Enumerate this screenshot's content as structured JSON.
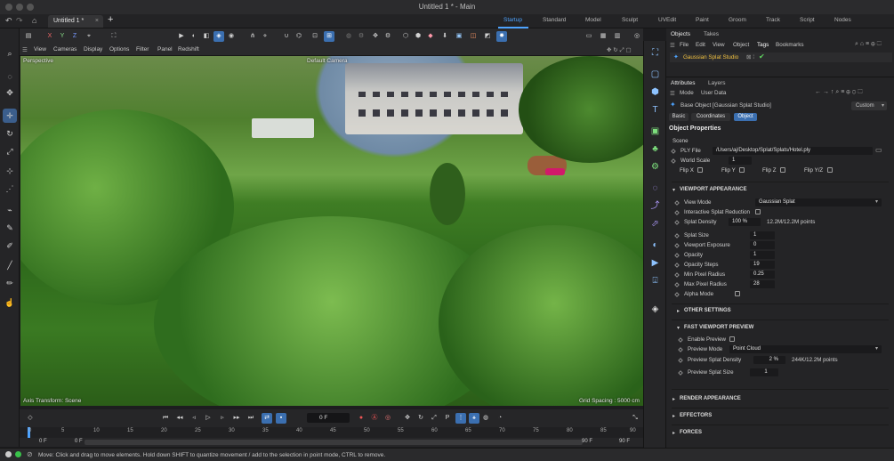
{
  "window": {
    "title": "Untitled 1 * - Main"
  },
  "tabs": {
    "doc_tab": "Untitled 1 *",
    "add": "+"
  },
  "layouts": [
    "Startup",
    "Standard",
    "Model",
    "Sculpt",
    "UVEdit",
    "Paint",
    "Groom",
    "Track",
    "Script",
    "Nodes"
  ],
  "toolbar_axes": {
    "x": "X",
    "y": "Y",
    "z": "Z"
  },
  "viewport": {
    "menu": [
      "View",
      "Cameras",
      "Display",
      "Options",
      "Filter",
      "Panel",
      "Redshift"
    ],
    "perspective": "Perspective",
    "camera": "Default Camera",
    "transform_label": "Axis Transform: Scene",
    "grid_label": "Grid Spacing : 5000 cm"
  },
  "timeline": {
    "frame_field": "0 F",
    "ruler_ticks": [
      "0",
      "5",
      "10",
      "15",
      "20",
      "25",
      "30",
      "35",
      "40",
      "45",
      "50",
      "55",
      "60",
      "65",
      "70",
      "75",
      "80",
      "85",
      "90"
    ],
    "start_a": "0 F",
    "start_b": "0 F",
    "end_a": "90 F",
    "end_b": "90 F"
  },
  "status": {
    "message": "Move: Click and drag to move elements. Hold down SHIFT to quantize movement / add to the selection in point mode, CTRL to remove."
  },
  "objects_panel": {
    "tabs": [
      "Objects",
      "Takes"
    ],
    "menu": [
      "File",
      "Edit",
      "View",
      "Object",
      "Tags",
      "Bookmarks"
    ],
    "object_name": "Gaussian Splat Studio"
  },
  "attributes": {
    "tabs": [
      "Attributes",
      "Layers"
    ],
    "menu": [
      "Mode",
      "User Data"
    ],
    "object_title": "Base Object [Gaussian Splat Studio]",
    "preset": "Custom",
    "subtabs": [
      "Basic",
      "Coordinates",
      "Object"
    ],
    "section_title": "Object Properties",
    "scene_label": "Scene",
    "ply_label": "PLY File",
    "ply_value": "/Users/aj/Desktop/Splat/Splats/Hotel.ply",
    "world_scale_label": "World Scale",
    "world_scale_value": "1",
    "flips": [
      "Flip X",
      "Flip Y",
      "Flip Z",
      "Flip Y/Z"
    ],
    "viewport_appearance": "VIEWPORT APPEARANCE",
    "view_mode_label": "View Mode",
    "view_mode_value": "Gaussian Splat",
    "interactive_label": "Interactive Splat Reduction",
    "splat_density_label": "Splat Density",
    "splat_density_value": "100 %",
    "splat_density_info": "12.2M/12.2M points",
    "splat_size_label": "Splat Size",
    "splat_size_value": "1",
    "exposure_label": "Viewport Exposure",
    "exposure_value": "0",
    "opacity_label": "Opacity",
    "opacity_value": "1",
    "opacity_steps_label": "Opacity Steps",
    "opacity_steps_value": "19",
    "min_radius_label": "Min Pixel Radius",
    "min_radius_value": "0.25",
    "max_radius_label": "Max Pixel Radius",
    "max_radius_value": "28",
    "alpha_label": "Alpha Mode",
    "other_settings": "OTHER SETTINGS",
    "fast_preview": "FAST VIEWPORT PREVIEW",
    "enable_preview_label": "Enable Preview",
    "preview_mode_label": "Preview Mode",
    "preview_mode_value": "Point Cloud",
    "preview_density_label": "Preview Splat Density",
    "preview_density_value": "2 %",
    "preview_density_info": "244K/12.2M points",
    "preview_size_label": "Preview Splat Size",
    "preview_size_value": "1",
    "render_appearance": "RENDER APPEARANCE",
    "effectors": "EFFECTORS",
    "forces": "FORCES"
  },
  "colors": {
    "accent": "#4da3ff",
    "selected": "#3b6fb0",
    "object_name": "#f0c040"
  }
}
